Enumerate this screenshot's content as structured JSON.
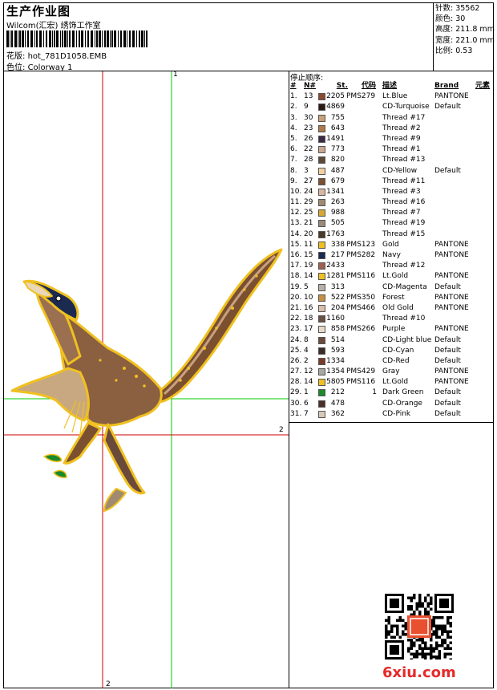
{
  "header": {
    "title": "生产作业图",
    "subtitle": "Wilcom(汇宏) 绣饰工作室",
    "design_label": "花版:",
    "design_value": "hot_781D1058.EMB",
    "colorway_label": "色位:",
    "colorway_value": "Colorway 1"
  },
  "stats": {
    "stitches": "针数: 35562",
    "colors": "颜色: 30",
    "height": "高度: 211.8 mm",
    "width": "宽度: 221.0 mm",
    "scale": "比例: 0.53"
  },
  "table": {
    "title": "停止顺序:",
    "headers": {
      "idx": "#",
      "n": "N#",
      "st": "St.",
      "code": "代码",
      "desc": "描述",
      "brand": "Brand",
      "element": "元素"
    },
    "rows": [
      {
        "i": "1.",
        "n": "13",
        "color": "#8a4a30",
        "st": "2205",
        "code": "PMS279",
        "desc": "Lt.Blue",
        "brand": "PANTONE"
      },
      {
        "i": "2.",
        "n": "9",
        "color": "#2a1a12",
        "st": "4869",
        "code": "",
        "desc": "CD-Turquoise",
        "brand": "Default"
      },
      {
        "i": "3.",
        "n": "30",
        "color": "#c9a07a",
        "st": "755",
        "code": "",
        "desc": "Thread #17",
        "brand": ""
      },
      {
        "i": "4.",
        "n": "23",
        "color": "#b07a4a",
        "st": "643",
        "code": "",
        "desc": "Thread #2",
        "brand": ""
      },
      {
        "i": "5.",
        "n": "26",
        "color": "#3a2a45",
        "st": "1491",
        "code": "",
        "desc": "Thread #9",
        "brand": ""
      },
      {
        "i": "6.",
        "n": "22",
        "color": "#c8a890",
        "st": "773",
        "code": "",
        "desc": "Thread #1",
        "brand": ""
      },
      {
        "i": "7.",
        "n": "28",
        "color": "#5a4a35",
        "st": "820",
        "code": "",
        "desc": "Thread #13",
        "brand": ""
      },
      {
        "i": "8.",
        "n": "3",
        "color": "#f0d0a0",
        "st": "487",
        "code": "",
        "desc": "CD-Yellow",
        "brand": "Default"
      },
      {
        "i": "9.",
        "n": "27",
        "color": "#7a5030",
        "st": "679",
        "code": "",
        "desc": "Thread #11",
        "brand": ""
      },
      {
        "i": "10.",
        "n": "24",
        "color": "#d8b8a0",
        "st": "1341",
        "code": "",
        "desc": "Thread #3",
        "brand": ""
      },
      {
        "i": "11.",
        "n": "29",
        "color": "#a08a70",
        "st": "263",
        "code": "",
        "desc": "Thread #16",
        "brand": ""
      },
      {
        "i": "12.",
        "n": "25",
        "color": "#d8a830",
        "st": "988",
        "code": "",
        "desc": "Thread #7",
        "brand": ""
      },
      {
        "i": "13.",
        "n": "21",
        "color": "#9a8a7a",
        "st": "505",
        "code": "",
        "desc": "Thread #19",
        "brand": ""
      },
      {
        "i": "14.",
        "n": "20",
        "color": "#4a3a2a",
        "st": "1763",
        "code": "",
        "desc": "Thread #15",
        "brand": ""
      },
      {
        "i": "15.",
        "n": "11",
        "color": "#f0c020",
        "st": "338",
        "code": "PMS123",
        "desc": "Gold",
        "brand": "PANTONE"
      },
      {
        "i": "16.",
        "n": "15",
        "color": "#1a2a50",
        "st": "217",
        "code": "PMS282",
        "desc": "Navy",
        "brand": "PANTONE"
      },
      {
        "i": "17.",
        "n": "19",
        "color": "#a06050",
        "st": "2433",
        "code": "",
        "desc": "Thread #12",
        "brand": ""
      },
      {
        "i": "18.",
        "n": "14",
        "color": "#f0c020",
        "st": "1281",
        "code": "PMS116",
        "desc": "Lt.Gold",
        "brand": "PANTONE"
      },
      {
        "i": "19.",
        "n": "5",
        "color": "#b8b0a8",
        "st": "313",
        "code": "",
        "desc": "CD-Magenta",
        "brand": "Default"
      },
      {
        "i": "20.",
        "n": "10",
        "color": "#c89040",
        "st": "522",
        "code": "PMS350",
        "desc": "Forest",
        "brand": "PANTONE"
      },
      {
        "i": "21.",
        "n": "16",
        "color": "#d8c0a8",
        "st": "204",
        "code": "PMS466",
        "desc": "Old Gold",
        "brand": "PANTONE"
      },
      {
        "i": "22.",
        "n": "18",
        "color": "#6a5040",
        "st": "1160",
        "code": "",
        "desc": "Thread #10",
        "brand": ""
      },
      {
        "i": "23.",
        "n": "17",
        "color": "#e8d8c8",
        "st": "858",
        "code": "PMS266",
        "desc": "Purple",
        "brand": "PANTONE"
      },
      {
        "i": "24.",
        "n": "8",
        "color": "#6a4a3a",
        "st": "514",
        "code": "",
        "desc": "CD-Light blue",
        "brand": "Default"
      },
      {
        "i": "25.",
        "n": "4",
        "color": "#3a2a28",
        "st": "593",
        "code": "",
        "desc": "CD-Cyan",
        "brand": "Default"
      },
      {
        "i": "26.",
        "n": "2",
        "color": "#7a3a2a",
        "st": "1334",
        "code": "",
        "desc": "CD-Red",
        "brand": "Default"
      },
      {
        "i": "27.",
        "n": "12",
        "color": "#a8a8a0",
        "st": "1354",
        "code": "PMS429",
        "desc": "Gray",
        "brand": "PANTONE"
      },
      {
        "i": "28.",
        "n": "14",
        "color": "#f0c020",
        "st": "5805",
        "code": "PMS116",
        "desc": "Lt.Gold",
        "brand": "PANTONE"
      },
      {
        "i": "29.",
        "n": "1",
        "color": "#1a8a2a",
        "st": "212",
        "code": "1",
        "desc": "Dark Green",
        "brand": "Default"
      },
      {
        "i": "30.",
        "n": "6",
        "color": "#4a3028",
        "st": "478",
        "code": "",
        "desc": "CD-Orange",
        "brand": "Default"
      },
      {
        "i": "31.",
        "n": "7",
        "color": "#d8c8b8",
        "st": "362",
        "code": "",
        "desc": "CD-Pink",
        "brand": "Default"
      }
    ]
  },
  "markers": {
    "v1": "1",
    "h2": "2",
    "v2": "2"
  },
  "logo": {
    "text": "6xiu.com"
  },
  "colors": {
    "guide_red": "#cc0000",
    "guide_green": "#00cc00",
    "outline": "#f0c020",
    "logo_red": "#e52a2a"
  }
}
